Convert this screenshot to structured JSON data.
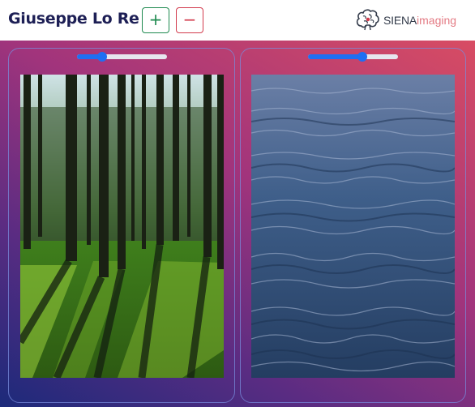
{
  "header": {
    "user_name": "Giuseppe Lo Re",
    "add_button": {
      "label": "+",
      "icon": "plus-icon",
      "color": "#1e8a4f"
    },
    "remove_button": {
      "label": "−",
      "icon": "minus-icon",
      "color": "#d23a4c"
    },
    "logo": {
      "text_bold": "SIENA",
      "text_light": "imaging",
      "icon": "brain-logo-icon"
    }
  },
  "colors": {
    "title": "#1d1f55",
    "slider_accent": "#1f6ff2",
    "gradient": [
      "#1c2a7a",
      "#5a2c82",
      "#a1347c",
      "#d84c63"
    ]
  },
  "panels": [
    {
      "slider_value": 0.28,
      "image": "forest-photo"
    },
    {
      "slider_value": 0.6,
      "image": "ocean-water-photo"
    }
  ]
}
